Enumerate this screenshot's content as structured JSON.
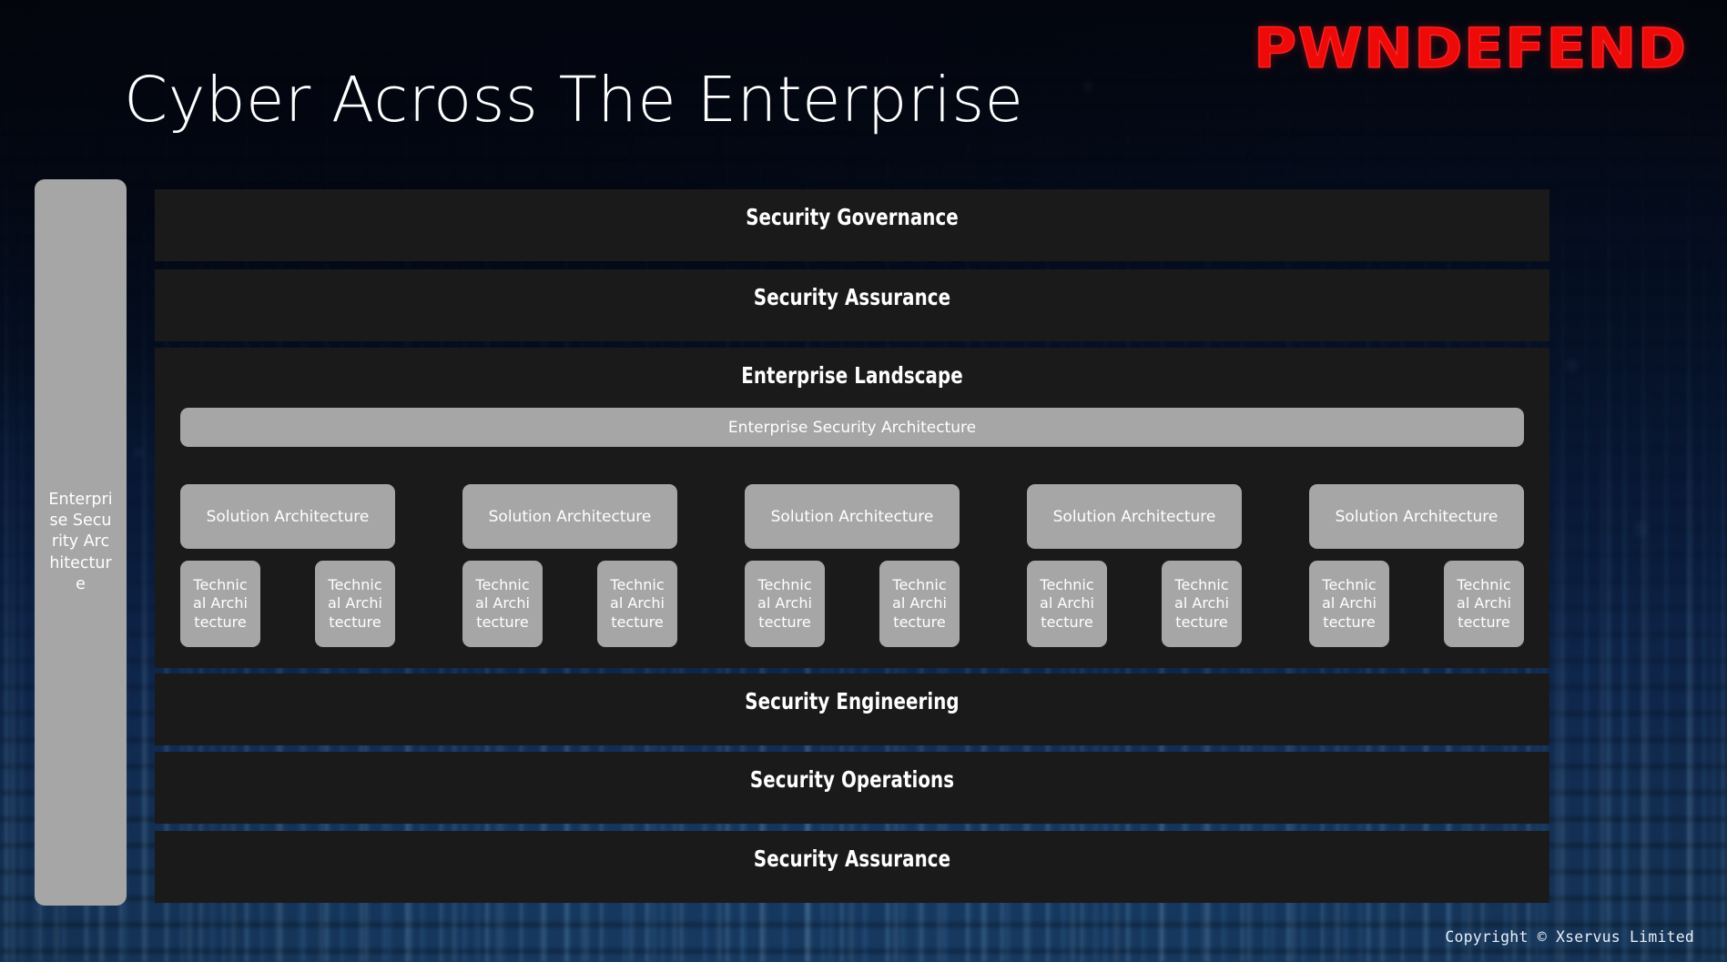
{
  "slide": {
    "title": "Cyber Across The Enterprise",
    "logo": "PWNDEFEND",
    "logo_color": "#ef0a0a",
    "copyright": "Copyright © Xservus Limited",
    "background_color": "#061228",
    "panel_color": "#1a1a1a",
    "box_color": "#a6a6a6",
    "text_color": "#ffffff"
  },
  "side_bar": {
    "label": "Enterprise Security Architecture"
  },
  "layers": [
    {
      "id": "security-governance",
      "label": "Security Governance"
    },
    {
      "id": "security-assurance-top",
      "label": "Security Assurance"
    },
    {
      "id": "enterprise-landscape",
      "label": "Enterprise Landscape"
    },
    {
      "id": "security-engineering",
      "label": "Security Engineering"
    },
    {
      "id": "security-operations",
      "label": "Security Operations"
    },
    {
      "id": "security-assurance-bottom",
      "label": "Security Assurance"
    }
  ],
  "enterprise_landscape": {
    "title": "Enterprise Landscape",
    "esa_bar_label": "Enterprise Security Architecture",
    "columns": [
      {
        "solution_label": "Solution Architecture",
        "technical": [
          "Technical Architecture",
          "Technical Architecture"
        ]
      },
      {
        "solution_label": "Solution Architecture",
        "technical": [
          "Technical Architecture",
          "Technical Architecture"
        ]
      },
      {
        "solution_label": "Solution Architecture",
        "technical": [
          "Technical Architecture",
          "Technical Architecture"
        ]
      },
      {
        "solution_label": "Solution Architecture",
        "technical": [
          "Technical Architecture",
          "Technical Architecture"
        ]
      },
      {
        "solution_label": "Solution Architecture",
        "technical": [
          "Technical Architecture",
          "Technical Architecture"
        ]
      }
    ]
  }
}
